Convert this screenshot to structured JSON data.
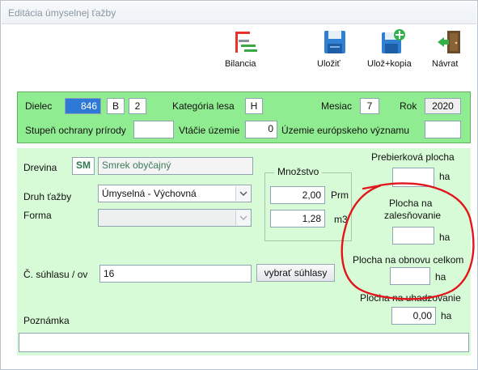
{
  "window": {
    "title": "Editácia  úmyselnej ťažby"
  },
  "toolbar": {
    "bilancia": "Bilancia",
    "ulozit": "Uložiť",
    "uloz_kopia": "Ulož+kopia",
    "navrat": "Návrat"
  },
  "header": {
    "dielec_label": "Dielec",
    "dielec_value": "846",
    "dielec_letter": "B",
    "dielec_num": "2",
    "kategoria_label": "Kategória lesa",
    "kategoria_value": "H",
    "mesiac_label": "Mesiac",
    "mesiac_value": "7",
    "rok_label": "Rok",
    "rok_value": "2020",
    "stupen_label": "Stupeň ochrany prírody",
    "stupen_value": "",
    "vtacie_label": "Vtáčie územie",
    "vtacie_value": "0",
    "uzemie_label": "Územie európskeho významu",
    "uzemie_value": ""
  },
  "form": {
    "drevina_label": "Drevina",
    "drevina_code": "SM",
    "drevina_name": "Smrek obyčajný",
    "druh_label": "Druh ťažby",
    "druh_value": "Úmyselná - Výchovná",
    "forma_label": "Forma",
    "forma_value": "",
    "mnozstvo_label": "Množstvo",
    "prm_value": "2,00",
    "prm_unit": "Prm",
    "m3_value": "1,28",
    "m3_unit": "m3",
    "suhlas_label": "Č. súhlasu / ov",
    "suhlas_value": "16",
    "vybrat_button": "vybrať súhlasy",
    "poznamka_label": "Poznámka",
    "poznamka_value": ""
  },
  "areas": {
    "prebierkova_label": "Prebierková plocha",
    "prebierkova_value": "",
    "zalesnovanie_label_1": "Plocha na",
    "zalesnovanie_label_2": "zalesňovanie",
    "zalesnovanie_value": "",
    "obnova_label": "Plocha na obnovu celkom",
    "obnova_value": "",
    "uhadzovanie_label": "Plocha na uhadzovanie",
    "uhadzovanie_value": "0,00",
    "unit": "ha"
  },
  "colors": {
    "header_green": "#90ec90",
    "form_green": "#d7fbd7",
    "selection_blue": "#2e79d8",
    "annotation_red": "#e0161c"
  }
}
